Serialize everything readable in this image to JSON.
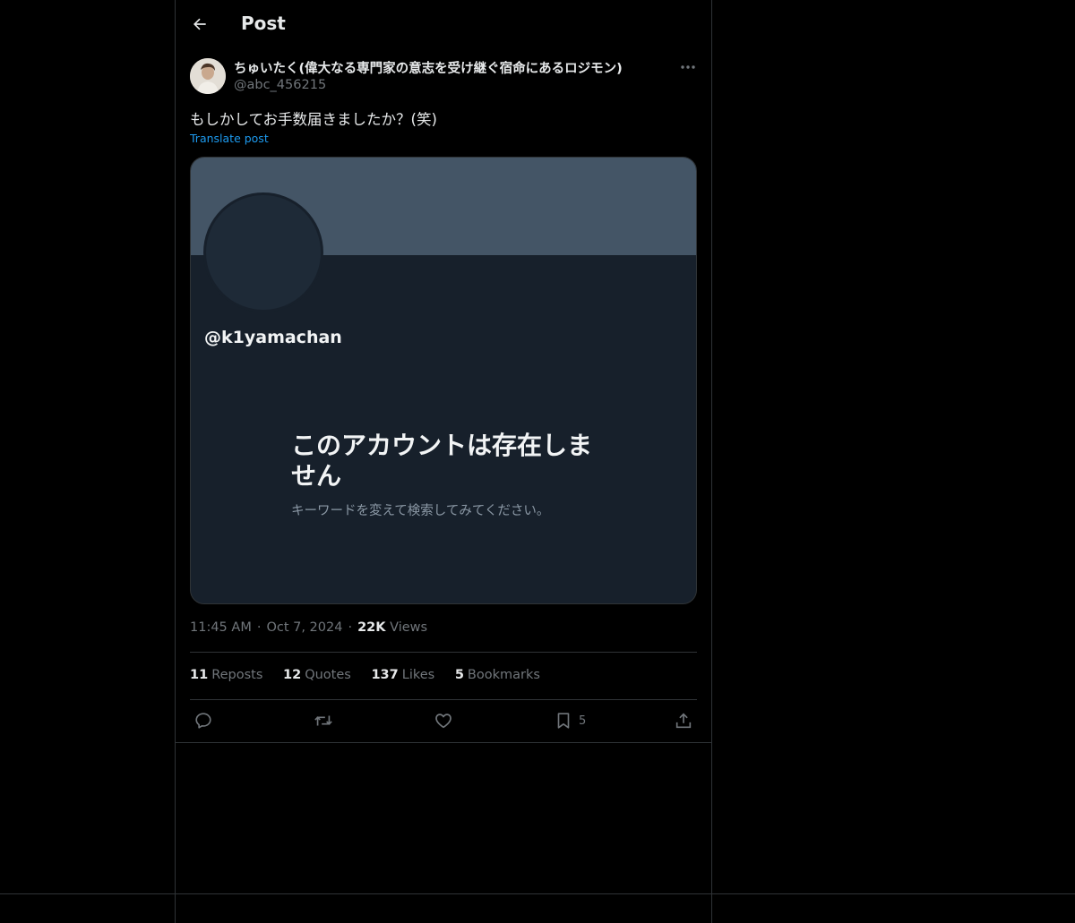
{
  "header": {
    "title": "Post"
  },
  "post": {
    "display_name": "ちゅいたく(偉大なる専門家の意志を受け継ぐ宿命にあるロジモン)",
    "handle": "@abc_456215",
    "text": "もしかしてお手数届きましたか？(笑)",
    "translate_label": "Translate post",
    "media": {
      "handle": "@k1yamachan",
      "message": "このアカウントは存在しません",
      "sub": "キーワードを変えて検索してみてください。"
    },
    "time": "11:45 AM",
    "date": "Oct 7, 2024",
    "views_count": "22K",
    "views_label": "Views",
    "stats": {
      "reposts_count": "11",
      "reposts_label": "Reposts",
      "quotes_count": "12",
      "quotes_label": "Quotes",
      "likes_count": "137",
      "likes_label": "Likes",
      "bookmarks_count": "5",
      "bookmarks_label": "Bookmarks"
    },
    "actions": {
      "bookmark_count": "5"
    }
  },
  "colors": {
    "background": "#000000",
    "text": "#e7e9ea",
    "muted": "#71767b",
    "link": "#1d9bf0",
    "border": "#2f3336"
  }
}
